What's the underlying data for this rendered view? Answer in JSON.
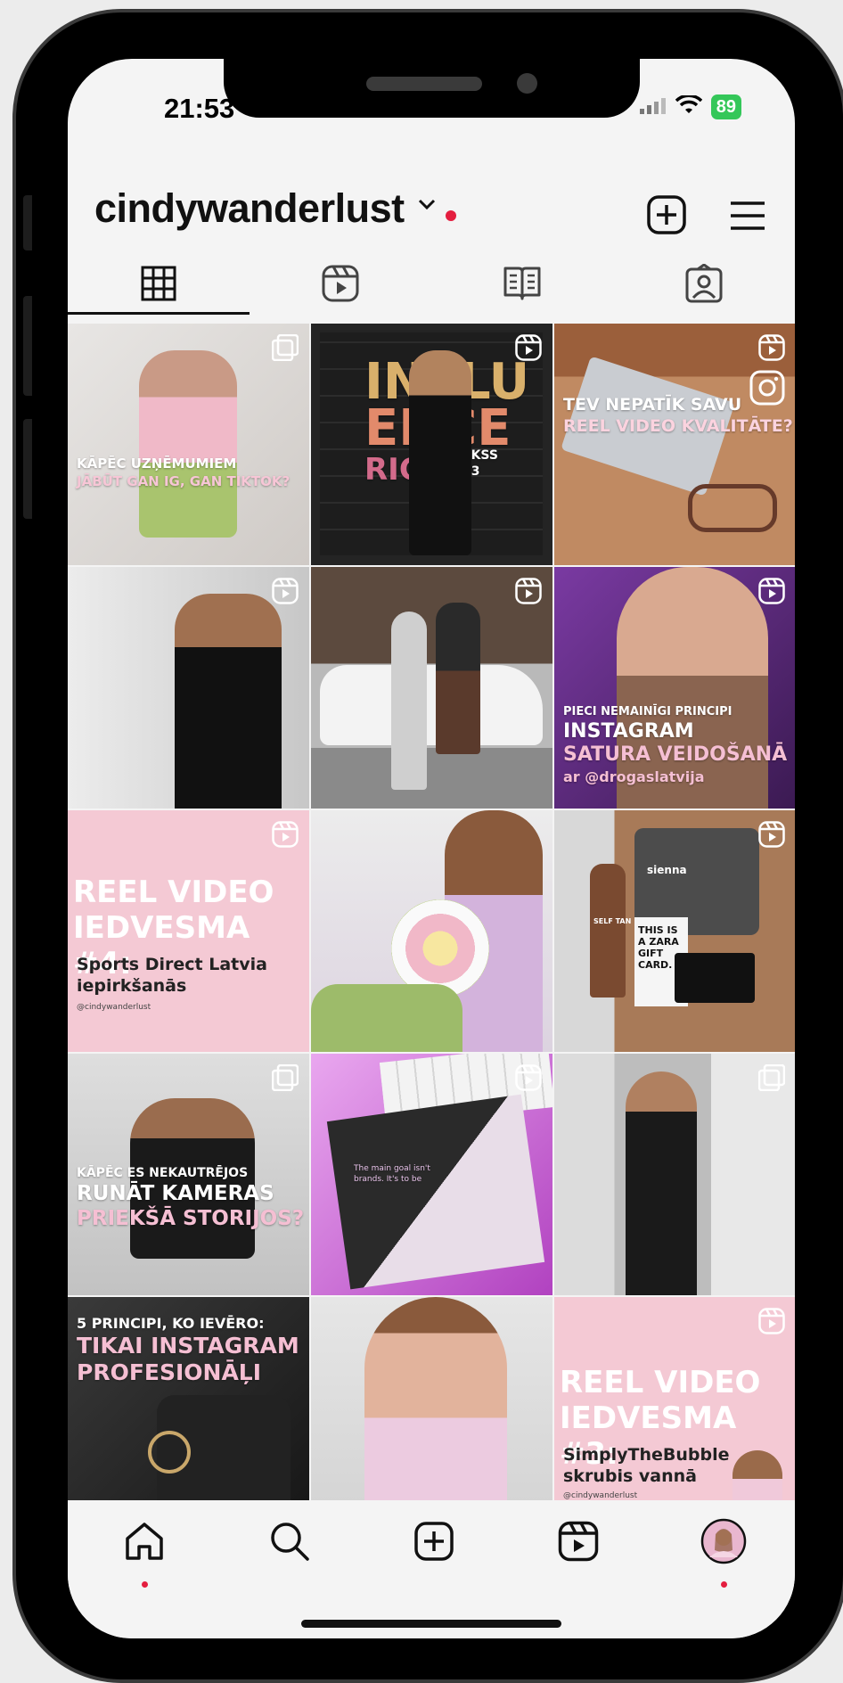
{
  "status_bar": {
    "time": "21:53",
    "battery": "89"
  },
  "profile": {
    "username": "cindywanderlust"
  },
  "tabs": [
    {
      "name": "grid",
      "icon": "grid-icon"
    },
    {
      "name": "reels",
      "icon": "reels-icon"
    },
    {
      "name": "guides",
      "icon": "guides-icon"
    },
    {
      "name": "tagged",
      "icon": "tagged-icon"
    }
  ],
  "posts": [
    {
      "type": "carousel",
      "bg": "#d9d6d3",
      "lines": [
        "KĀPĒC UZŅĒMUMIEM",
        "JĀBŪT GAN IG, GAN TIKTOK?"
      ]
    },
    {
      "type": "reel",
      "bg": "#2a2a2a",
      "lines": [
        "INFLU",
        "ENCE",
        "RIGA",
        "EKSS",
        "23"
      ]
    },
    {
      "type": "reel",
      "bg": "#a06a45",
      "lines": [
        "TEV NEPATĪK SAVU",
        "REEL VIDEO KVALITĀTE?"
      ]
    },
    {
      "type": "reel",
      "bg": "#d4d4d4",
      "lines": []
    },
    {
      "type": "reel",
      "bg": "#8f9590",
      "lines": []
    },
    {
      "type": "reel",
      "bg": "#5a2a76",
      "lines": [
        "PIECI NEMAINĪGI PRINCIPI",
        "INSTAGRAM",
        "SATURA VEIDOŠANĀ",
        "ar @drogaslatvija"
      ]
    },
    {
      "type": "reel",
      "bg": "#f4c9d4",
      "lines": [
        "REEL VIDEO",
        "IEDVESMA #4:",
        "Sports Direct Latvia",
        "iepirkšanās",
        "@cindywanderlust"
      ]
    },
    {
      "type": "image",
      "bg": "#d9c8dc",
      "lines": []
    },
    {
      "type": "reel",
      "bg": "#b98f6f",
      "lines": [
        "sienna",
        "SELF TAN",
        "THIS IS A ZARA GIFT CARD."
      ]
    },
    {
      "type": "carousel",
      "bg": "#c9c9c9",
      "lines": [
        "KĀPĒC ES NEKAUTRĒJOS",
        "RUNĀT KAMERAS",
        "PRIEKŠĀ STORIJOS?"
      ]
    },
    {
      "type": "reel",
      "bg": "#c75ed0",
      "lines": [
        "The main goal isn't",
        "brands. It's to be"
      ]
    },
    {
      "type": "carousel",
      "bg": "#c8c8c8",
      "lines": []
    },
    {
      "type": "image",
      "bg": "#2b2b2b",
      "lines": [
        "5 PRINCIPI, KO IEVĒRO:",
        "TIKAI INSTAGRAM",
        "PROFESIONĀĻI"
      ]
    },
    {
      "type": "image",
      "bg": "#dcd2d4",
      "lines": []
    },
    {
      "type": "reel",
      "bg": "#f4c9d4",
      "lines": [
        "REEL VIDEO",
        "IEDVESMA #3:",
        "SimplyTheBubble",
        "skrubis vannā",
        "@cindywanderlust"
      ]
    }
  ],
  "nav": [
    {
      "name": "home",
      "icon": "home-icon"
    },
    {
      "name": "search",
      "icon": "search-icon"
    },
    {
      "name": "create",
      "icon": "create-icon"
    },
    {
      "name": "reels",
      "icon": "reels-icon"
    },
    {
      "name": "profile",
      "icon": "avatar-icon"
    }
  ],
  "colors": {
    "accent_red": "#e41e3f",
    "battery_green": "#34c759",
    "pink_tile": "#f4c9d4"
  }
}
